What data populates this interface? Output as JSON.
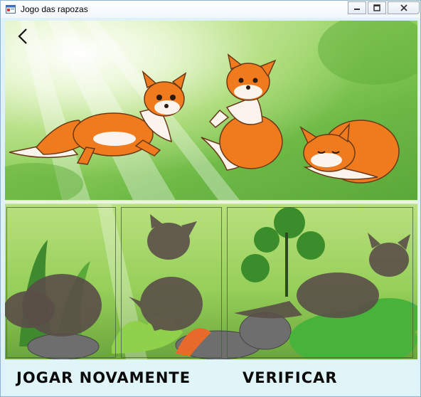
{
  "window": {
    "title": "Jogo das rapozas",
    "controls": {
      "minimize": "minimize",
      "maximize": "maximize",
      "close": "close"
    }
  },
  "game": {
    "pieces": [
      {
        "name": "running-fox",
        "pose": "running"
      },
      {
        "name": "sitting-fox",
        "pose": "sitting"
      },
      {
        "name": "sleeping-fox",
        "pose": "sleeping"
      }
    ],
    "targets": [
      {
        "name": "slot-1",
        "silhouette": "sleeping"
      },
      {
        "name": "slot-2",
        "silhouette": "sitting"
      },
      {
        "name": "slot-3",
        "silhouette": "running"
      }
    ]
  },
  "buttons": {
    "play_again": "JOGAR NOVAMENTE",
    "verify": "VERIFICAR"
  },
  "colors": {
    "fox_orange": "#f07a1e",
    "fox_white": "#fbf4ec",
    "silhouette": "#5a4f48",
    "grass_top": "#8fcf5d",
    "grass_bottom": "#6aa53c",
    "bar": "#dff5f8"
  },
  "icons": {
    "back": "back-arrow-icon",
    "app": "app-window-icon"
  }
}
